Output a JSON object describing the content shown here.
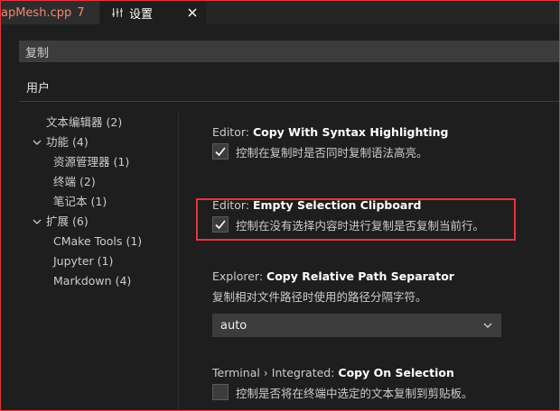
{
  "tabs": [
    {
      "title": "apMesh.cpp",
      "badge": "7"
    },
    {
      "title": "设置"
    }
  ],
  "search": {
    "value": "复制"
  },
  "scope": {
    "label": "用户"
  },
  "toc": [
    {
      "label": "文本编辑器",
      "count": "(2)",
      "level": 0,
      "expandable": false
    },
    {
      "label": "功能",
      "count": "(4)",
      "level": 0,
      "expandable": true
    },
    {
      "label": "资源管理器",
      "count": "(1)",
      "level": 1,
      "expandable": false
    },
    {
      "label": "终端",
      "count": "(2)",
      "level": 1,
      "expandable": false
    },
    {
      "label": "笔记本",
      "count": "(1)",
      "level": 1,
      "expandable": false
    },
    {
      "label": "扩展",
      "count": "(6)",
      "level": 0,
      "expandable": true
    },
    {
      "label": "CMake Tools",
      "count": "(1)",
      "level": 1,
      "expandable": false
    },
    {
      "label": "Jupyter",
      "count": "(1)",
      "level": 1,
      "expandable": false
    },
    {
      "label": "Markdown",
      "count": "(4)",
      "level": 1,
      "expandable": false
    }
  ],
  "settings": {
    "copy_syntax": {
      "category": "Editor: ",
      "name": "Copy With Syntax Highlighting",
      "description": "控制在复制时是否同时复制语法高亮。",
      "checked": true
    },
    "empty_selection": {
      "category": "Editor: ",
      "name": "Empty Selection Clipboard",
      "description": "控制在没有选择内容时进行复制是否复制当前行。",
      "checked": true
    },
    "relative_path": {
      "category": "Explorer: ",
      "name": "Copy Relative Path Separator",
      "description": "复制相对文件路径时使用的路径分隔字符。",
      "value": "auto"
    },
    "copy_on_selection": {
      "category": "Terminal › Integrated: ",
      "name": "Copy On Selection",
      "description": "控制是否将在终端中选定的文本复制到剪贴板。",
      "checked": false
    }
  },
  "colors": {
    "accent_red": "#e8323c",
    "tab_error": "#f48771",
    "background": "#1e1e1e"
  }
}
